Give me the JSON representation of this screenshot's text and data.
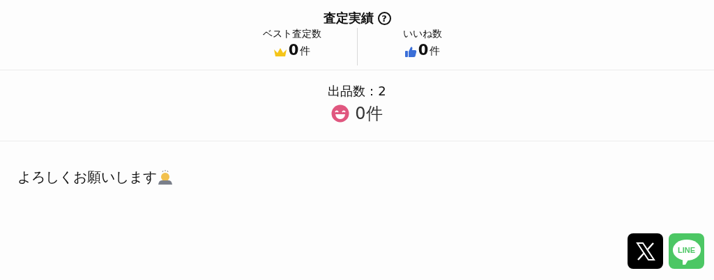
{
  "appraisal": {
    "title": "査定実績",
    "help_icon": "?",
    "stats": [
      {
        "kind": "best",
        "label": "ベスト査定数",
        "count": "0",
        "unit": "件"
      },
      {
        "kind": "like",
        "label": "いいね数",
        "count": "0",
        "unit": "件"
      }
    ]
  },
  "listings": {
    "label": "出品数：2",
    "count": "0件"
  },
  "message": "よろしくお願いします",
  "share": [
    {
      "kind": "x"
    },
    {
      "kind": "line",
      "label": "LINE"
    }
  ]
}
